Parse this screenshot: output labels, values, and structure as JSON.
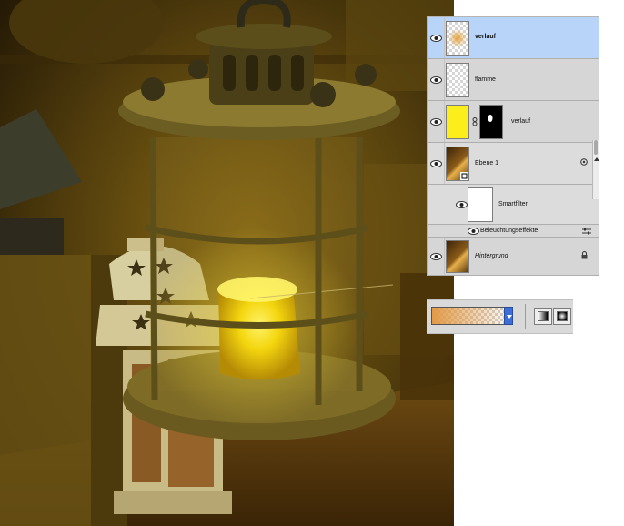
{
  "layers_panel": {
    "layers": [
      {
        "name": "verlauf",
        "visible": true,
        "selected": true,
        "thumb": "gradient-blob"
      },
      {
        "name": "flamme",
        "visible": true,
        "selected": false,
        "thumb": "transparent"
      },
      {
        "name": "verlauf",
        "visible": true,
        "selected": false,
        "thumb": "yellow-fill-with-mask"
      },
      {
        "name": "Ebene 1",
        "visible": true,
        "selected": false,
        "thumb": "photo",
        "badge": "smart-object"
      },
      {
        "name": "Smartfilter",
        "visible": true,
        "selected": false,
        "thumb": "white"
      },
      {
        "name": "Beleuchtungseffekte",
        "visible": true,
        "selected": false,
        "thumb": "none"
      },
      {
        "name": "Hintergrund",
        "visible": true,
        "selected": false,
        "thumb": "photo",
        "locked": true
      }
    ]
  },
  "options_bar": {
    "gradient_colors": [
      "#e29a46",
      "transparent"
    ],
    "gradient_types": [
      "linear-gradient-icon",
      "radial-gradient-icon"
    ]
  },
  "colors": {
    "selection": "#b8d4f8",
    "panel_bg": "#d9d9d9",
    "photo_tone": "#7a5a10"
  }
}
